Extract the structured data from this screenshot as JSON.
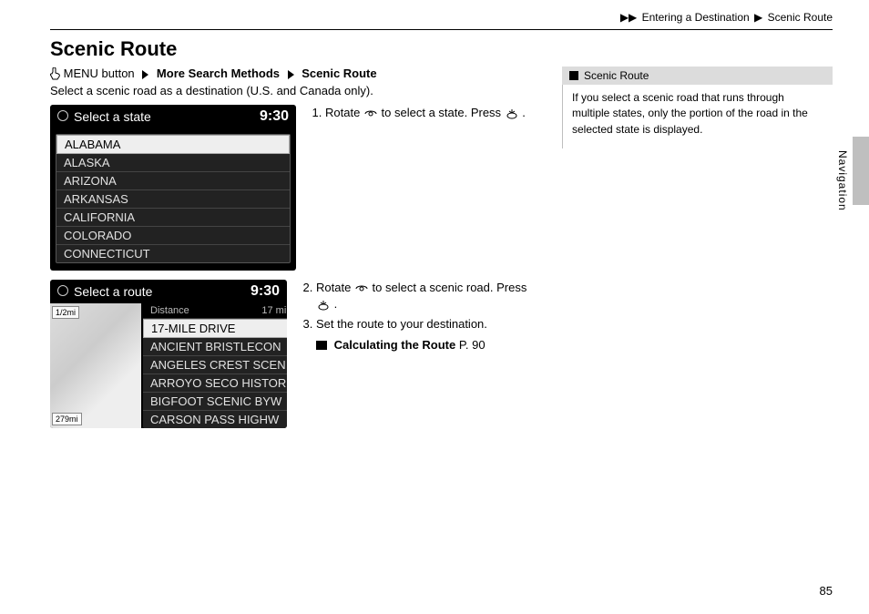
{
  "breadcrumb": {
    "l1": "Entering a Destination",
    "l2": "Scenic Route"
  },
  "title": "Scenic Route",
  "edge_label": "Navigation",
  "page_number": "85",
  "navpath": {
    "menu": "MENU button",
    "more_search": "More Search Methods",
    "scenic": "Scenic Route"
  },
  "subtitle": "Select a scenic road as a destination (U.S. and Canada only).",
  "steps": {
    "s1_a": "Rotate ",
    "s1_b": " to select a state. Press ",
    "s1_c": ".",
    "s2_a": "Rotate ",
    "s2_b": " to select a scenic road. Press ",
    "s2_c": ".",
    "s3": "Set the route to your destination.",
    "crossref_label": "Calculating the Route",
    "crossref_page": "P. 90"
  },
  "screen1": {
    "title": "Select a state",
    "time": "9:30",
    "items": [
      "ALABAMA",
      "ALASKA",
      "ARIZONA",
      "ARKANSAS",
      "CALIFORNIA",
      "COLORADO",
      "CONNECTICUT"
    ]
  },
  "screen2": {
    "title": "Select a route",
    "time": "9:30",
    "sub_l": "Distance",
    "sub_r": "17 mi",
    "scale_top": "1/2mi",
    "scale_bot": "279mi",
    "items": [
      "17-MILE DRIVE",
      "ANCIENT BRISTLECON",
      "ANGELES CREST SCEN",
      "ARROYO SECO HISTOR",
      "BIGFOOT SCENIC BYW",
      "CARSON PASS HIGHW"
    ]
  },
  "note": {
    "heading": "Scenic Route",
    "body": "If you select a scenic road that runs through multiple states, only the portion of the road in the selected state is displayed."
  }
}
